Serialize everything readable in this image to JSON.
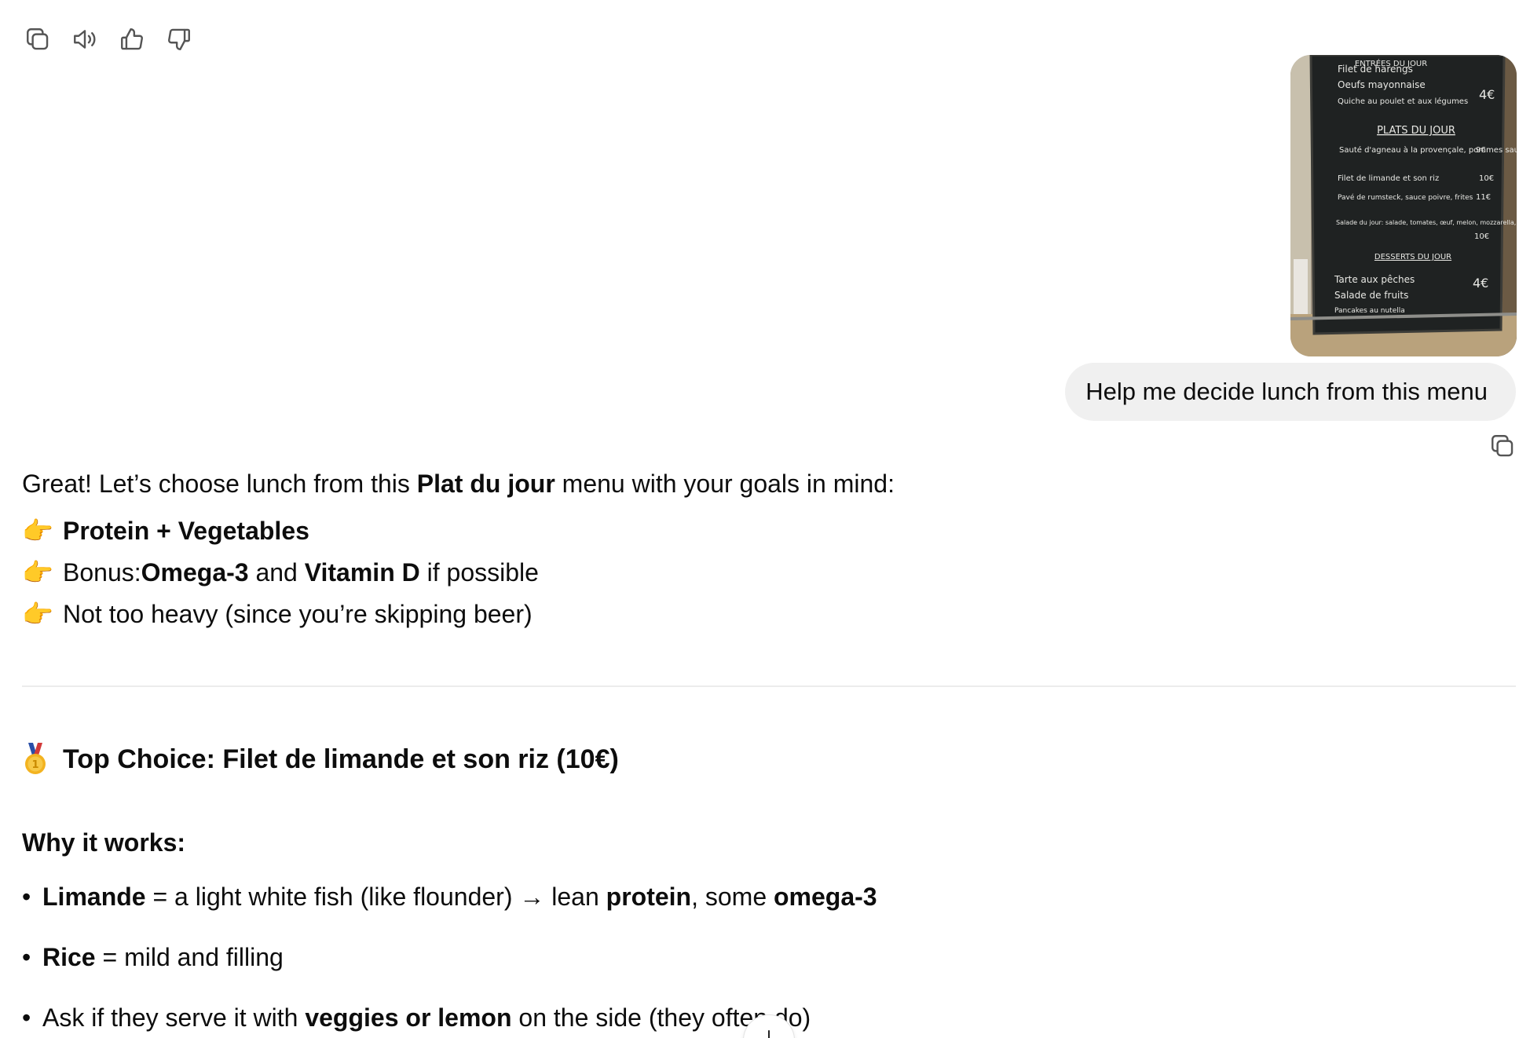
{
  "actions": {
    "copy_icon": "copy-icon",
    "speaker_icon": "speaker-icon",
    "thumbs_up_icon": "thumbs-up-icon",
    "thumbs_down_icon": "thumbs-down-icon"
  },
  "user_message": {
    "image_menu_text": {
      "entrees_title": "ENTRÉES DU JOUR",
      "entrees": [
        "Filet de harengs",
        "Oeufs mayonnaise",
        "Quiche au poulet et aux légumes"
      ],
      "entrees_price": "4€",
      "plats_title": "PLATS DU JOUR",
      "plats": [
        {
          "name": "Sauté d'agneau à la provençale, pommes sautées",
          "price": "9€"
        },
        {
          "name": "Filet de limande et son riz",
          "price": "10€"
        },
        {
          "name": "Pavé de rumsteck, sauce poivre, frites",
          "price": "11€"
        },
        {
          "name": "Salade du jour: salade, tomates, œuf, melon, mozzarella, poulet tandoori",
          "price": "10€"
        }
      ],
      "desserts_title": "DESSERTS DU JOUR",
      "desserts": [
        "Tarte aux pêches",
        "Salade de fruits",
        "Pancakes au nutella"
      ],
      "desserts_price": "4€"
    },
    "text": "Help me decide lunch from this menu"
  },
  "assistant": {
    "intro_pre": "Great! Let’s choose lunch from this ",
    "intro_bold": "Plat du jour",
    "intro_post": " menu with your goals in mind:",
    "point_emoji": "👉",
    "point1_bold": "Protein + Vegetables",
    "point2_pre": "Bonus: ",
    "point2_bold1": "Omega-3",
    "point2_mid": " and ",
    "point2_bold2": "Vitamin D",
    "point2_post": " if possible",
    "point3": "Not too heavy (since you’re skipping beer)",
    "top_choice": "Top Choice: Filet de limande et son riz (10€)",
    "why_heading": "Why it works:",
    "bullet_char": "•",
    "b1_bold": "Limande",
    "b1_text1": " = a light white fish (like flounder) → lean ",
    "b1_bold2": "protein",
    "b1_text2": ", some ",
    "b1_bold3": "omega-3",
    "b2_bold": "Rice",
    "b2_text": " = mild and filling",
    "b3_pre": "Ask if they serve it with ",
    "b3_bold": "veggies or lemon",
    "b3_post": " on the side (they often do)"
  },
  "scroll_button_icon": "arrow-down-icon"
}
